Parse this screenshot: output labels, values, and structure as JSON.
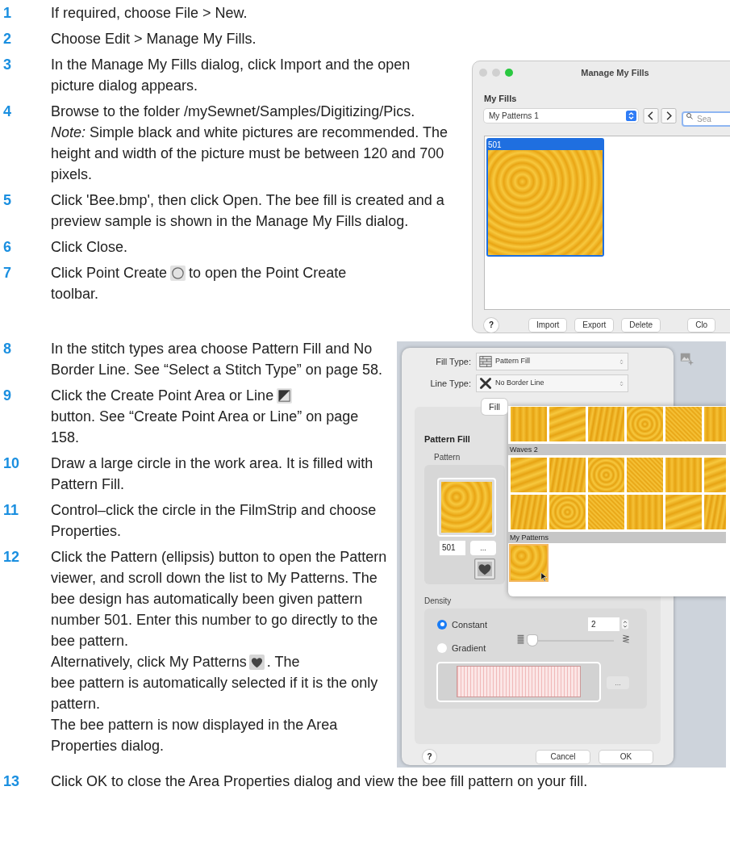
{
  "steps": [
    {
      "number": "1",
      "paragraphs": [
        {
          "text": "If required, choose File > New."
        }
      ]
    },
    {
      "number": "2",
      "paragraphs": [
        {
          "text": "Choose Edit > Manage My Fills."
        }
      ]
    },
    {
      "number": "3",
      "paragraphs": [
        {
          "text": "In the Manage My Fills dialog, click Import and the open picture dialog appears."
        }
      ]
    },
    {
      "number": "4",
      "paragraphs": [
        {
          "text": "Browse to the folder /mySewnet/Samples/Digitizing/Pics."
        },
        {
          "text": "*Note:* Simple black and white pictures are recommended. The height and width of the picture must be between 120 and 700 pixels."
        }
      ]
    },
    {
      "number": "5",
      "paragraphs": [
        {
          "text": "Click 'Bee.bmp', then click Open. The bee fill is created and a preview sample is shown in the Manage My Fills dialog."
        }
      ]
    },
    {
      "number": "6",
      "paragraphs": [
        {
          "text": "Click Close."
        }
      ]
    },
    {
      "number": "7",
      "paragraphs": [
        {
          "kind": "with_icon",
          "text": "Click Point Create",
          "after": "to open the Point Create",
          "rest": "toolbar."
        }
      ]
    },
    {
      "number": "8",
      "paragraphs": [
        {
          "text": "In the stitch types area choose Pattern Fill and No Border Line. See “Select a Stitch Type” on page 58."
        }
      ]
    },
    {
      "number": "9",
      "paragraphs": [
        {
          "kind": "with_icon",
          "text": "Click the Create Point Area or Line",
          "rest": "button. See “Create Point Area or Line” on page 158."
        }
      ]
    },
    {
      "number": "10",
      "paragraphs": [
        {
          "text": "Draw a large circle in the work area. It is filled with Pattern Fill."
        }
      ]
    },
    {
      "number": "11",
      "paragraphs": [
        {
          "text": "Control–click the circle in the FilmStrip and choose Properties."
        }
      ]
    },
    {
      "number": "12",
      "paragraphs": [
        {
          "text": "Click the Pattern (ellipsis) button to open the Pattern viewer, and scroll down the list to My Patterns. The bee design has automatically been given pattern number 501. Enter this number to go directly to the bee pattern."
        },
        {
          "kind": "with_icon",
          "text": "Alternatively, click My Patterns",
          "after": ". The",
          "rest": "bee pattern is automatically selected if it is the only pattern."
        },
        {
          "text": "The bee pattern is now displayed in the Area Properties dialog."
        }
      ]
    },
    {
      "number": "13",
      "paragraphs": [
        {
          "text": "Click OK to close the Area Properties dialog and view the bee fill pattern on your fill."
        }
      ]
    }
  ],
  "manage_my_fills_dialog": {
    "title": "Manage My Fills",
    "section_label": "My Fills",
    "folder": "My Patterns 1",
    "search": {
      "placeholder": "Sea"
    },
    "fills": [
      {
        "label": "501",
        "selected": true
      }
    ],
    "help_button": "?",
    "buttons": [
      "Import",
      "Export",
      "Delete",
      "Clo"
    ]
  },
  "area_properties_dialog": {
    "fill_type": {
      "label": "Fill Type:",
      "value": "Pattern Fill"
    },
    "line_type": {
      "label": "Line Type:",
      "value": "No Border Line"
    },
    "tabs": [
      {
        "label": "Fill",
        "selected": true
      }
    ],
    "group_title": "Pattern Fill",
    "pattern_label": "Pattern",
    "pattern_number": "501",
    "pattern_button": "...",
    "pattern_viewer": {
      "groups": [
        {
          "tiles": [
            {
              "selected": false
            },
            {
              "selected": false
            },
            {
              "selected": false
            },
            {
              "selected": false
            },
            {
              "selected": false
            },
            {
              "selected": false
            }
          ]
        },
        {
          "header": "Waves 2",
          "tiles": [
            {
              "selected": false
            },
            {
              "selected": false
            },
            {
              "selected": false
            },
            {
              "selected": false
            },
            {
              "selected": false
            },
            {
              "selected": false
            },
            {
              "selected": false
            },
            {
              "selected": false
            },
            {
              "selected": false
            },
            {
              "selected": false
            },
            {
              "selected": false
            },
            {
              "selected": false
            }
          ]
        },
        {
          "header": "My Patterns",
          "tiles": [
            {
              "selected": true
            }
          ]
        }
      ]
    },
    "density_label": "Density",
    "density_options": [
      {
        "label": "Constant",
        "selected": true
      },
      {
        "label": "Gradient",
        "selected": false
      }
    ],
    "density_value": "2",
    "density_slider": {
      "level": 0
    },
    "preview_button": {
      "label": "...",
      "disabled": true
    },
    "help_button": "?",
    "buttons": [
      "Cancel",
      "OK"
    ]
  }
}
